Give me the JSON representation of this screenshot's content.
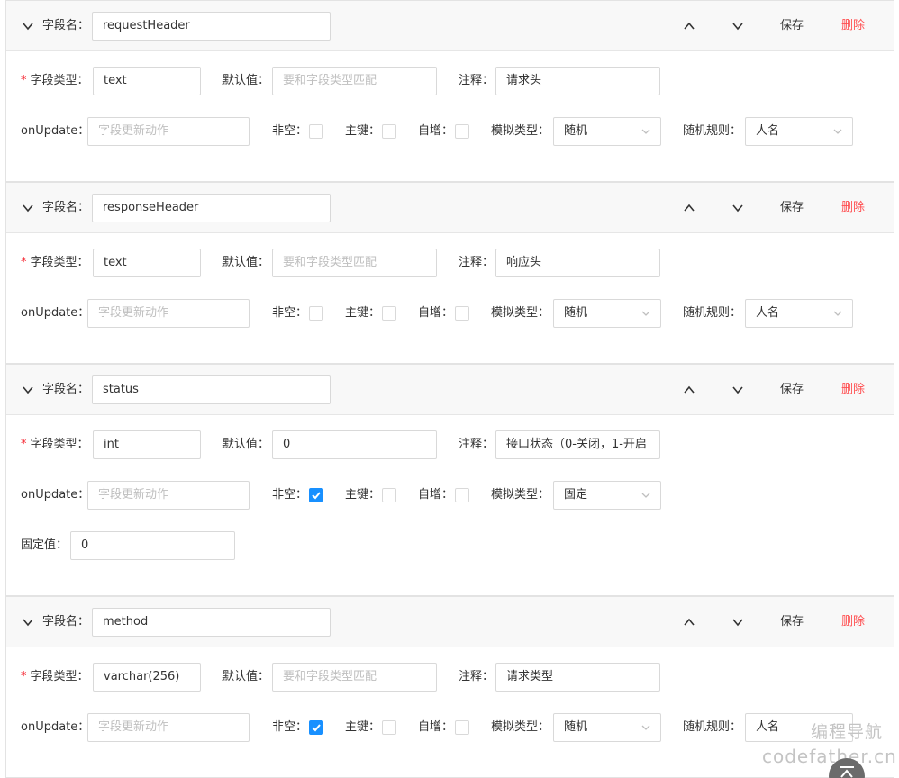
{
  "labels": {
    "field_name": "字段名：",
    "field_type": "字段类型：",
    "default_value": "默认值：",
    "comment": "注释：",
    "on_update": "onUpdate：",
    "not_null": "非空：",
    "primary_key": "主键：",
    "auto_increment": "自增：",
    "mock_type": "模拟类型：",
    "random_rule": "随机规则：",
    "fixed_value": "固定值："
  },
  "required_mark": "*",
  "placeholders": {
    "default_value": "要和字段类型匹配",
    "on_update": "字段更新动作"
  },
  "actions": {
    "save": "保存",
    "delete": "删除"
  },
  "fields": [
    {
      "name": "requestHeader",
      "type": "text",
      "default_value": "",
      "comment": "请求头",
      "on_update": "",
      "not_null": false,
      "primary_key": false,
      "auto_increment": false,
      "mock_type": "随机",
      "random_rule": "人名"
    },
    {
      "name": "responseHeader",
      "type": "text",
      "default_value": "",
      "comment": "响应头",
      "on_update": "",
      "not_null": false,
      "primary_key": false,
      "auto_increment": false,
      "mock_type": "随机",
      "random_rule": "人名"
    },
    {
      "name": "status",
      "type": "int",
      "default_value": "0",
      "comment": "接口状态（0-关闭，1-开启",
      "on_update": "",
      "not_null": true,
      "primary_key": false,
      "auto_increment": false,
      "mock_type": "固定",
      "fixed_value": "0"
    },
    {
      "name": "method",
      "type": "varchar(256)",
      "default_value": "",
      "comment": "请求类型",
      "on_update": "",
      "not_null": true,
      "primary_key": false,
      "auto_increment": false,
      "mock_type": "随机",
      "random_rule": "人名"
    }
  ],
  "watermark": {
    "line1": "编程导航",
    "line2": "codefather.cn"
  },
  "colors": {
    "primary": "#1890ff",
    "danger": "#ff4d4f",
    "required": "#f5222d",
    "header_bg": "#f8f8f8",
    "border": "#d9d9d9"
  }
}
